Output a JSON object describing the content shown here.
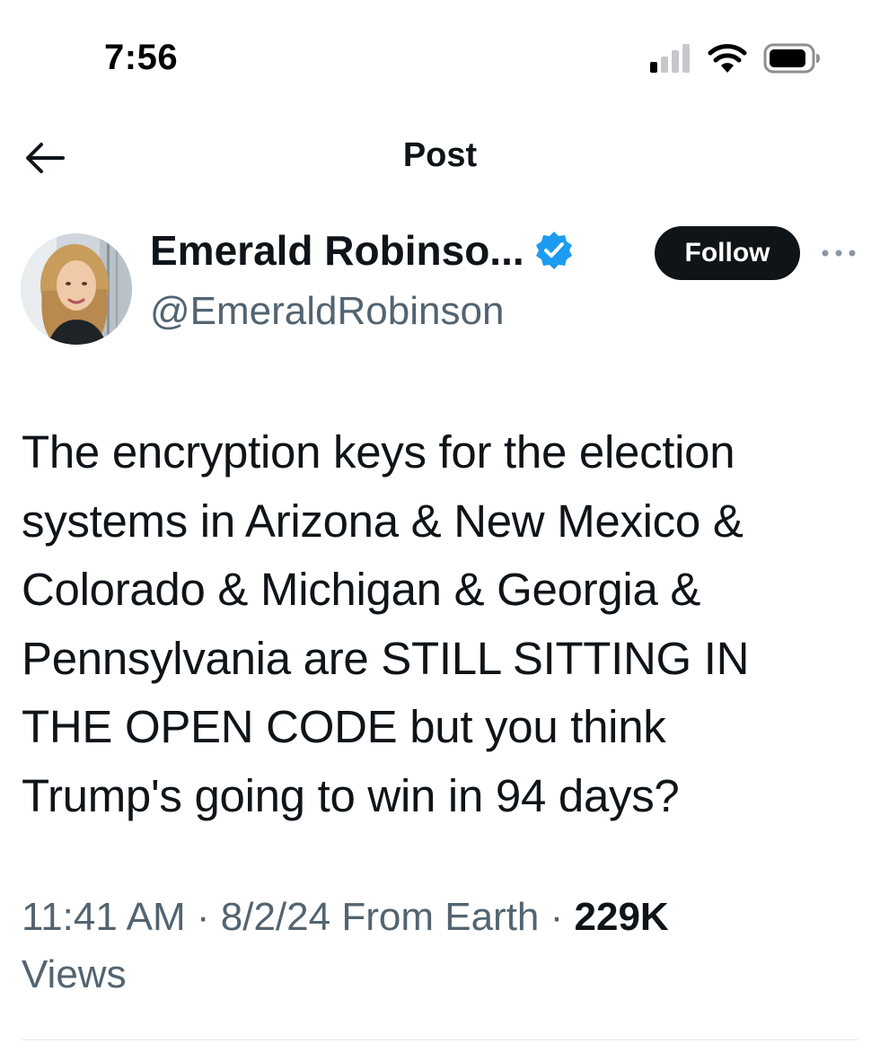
{
  "status_bar": {
    "time": "7:56",
    "icons": [
      "signal-icon",
      "wifi-icon",
      "battery-icon"
    ]
  },
  "header": {
    "title": "Post",
    "back_icon": "arrow-left-icon"
  },
  "author": {
    "display_name": "Emerald Robinso...",
    "handle": "@EmeraldRobinson",
    "verified": true,
    "verified_color": "#1d9bf0",
    "follow_label": "Follow",
    "more_icon": "ellipsis-icon"
  },
  "post": {
    "text": "The encryption keys for the election\nsystems in Arizona & New Mexico &\nColorado & Michigan & Georgia &\nPennsylvania are STILL SITTING IN\nTHE OPEN CODE but you think\nTrump's going to win in 94 days?",
    "time": "11:41 AM",
    "separator": "·",
    "date": "8/2/24",
    "source": "From Earth",
    "views_count": "229K",
    "views_label": "Views"
  },
  "colors": {
    "text_primary": "#0f1419",
    "text_secondary": "#536471",
    "follow_bg": "#0f1419",
    "verified": "#1d9bf0"
  }
}
